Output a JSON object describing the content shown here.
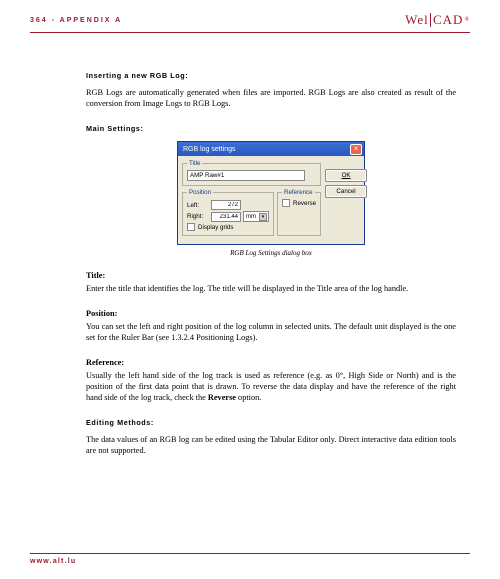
{
  "header": {
    "page_label": "364 - APPENDIX A",
    "brand_left": "Wel",
    "brand_right": "CAD",
    "brand_tm": "®"
  },
  "sections": {
    "insert_title": "Inserting a new RGB Log:",
    "insert_para": "RGB Logs are automatically generated when files are imported. RGB Logs are also created as result of the conversion from Image Logs to RGB Logs.",
    "main_settings_title": "Main Settings:",
    "dialog": {
      "title": "RGB log settings",
      "close_glyph": "×",
      "title_group": "Title",
      "title_value": "AMP Raw#1",
      "position_group": "Position",
      "left_label": "Left:",
      "left_value": "272",
      "right_label": "Right:",
      "right_value": "231.44",
      "unit": "mm",
      "dd_glyph": "▾",
      "reference_group": "Reference",
      "reverse_label": "Reverse",
      "displaygrids_label": "Display grids",
      "ok_btn": "OK",
      "cancel_btn": "Cancel"
    },
    "dialog_caption": "RGB Log Settings dialog box",
    "title_head": "Title:",
    "title_para": "Enter the title that identifies the log. The title will be displayed in the Title area of the log handle.",
    "position_head": "Position:",
    "position_para": "You can set the left and right position of the log column in selected units. The default unit displayed is the one set for the Ruler Bar (see 1.3.2.4 Positioning Logs).",
    "reference_head": "Reference:",
    "reference_para_a": "Usually the left hand side of the log track is used as reference (e.g. as 0°, High Side or North) and is the position of the first data point that is drawn. To reverse the data display and have the reference of the right hand side of the log track, check the ",
    "reference_para_b": "Reverse",
    "reference_para_c": " option.",
    "editing_title": "Editing Methods:",
    "editing_para": "The data values of an RGB log can be edited using the Tabular Editor only. Direct interactive data edition tools are not supported."
  },
  "footer": {
    "url": "www.alt.lu"
  }
}
